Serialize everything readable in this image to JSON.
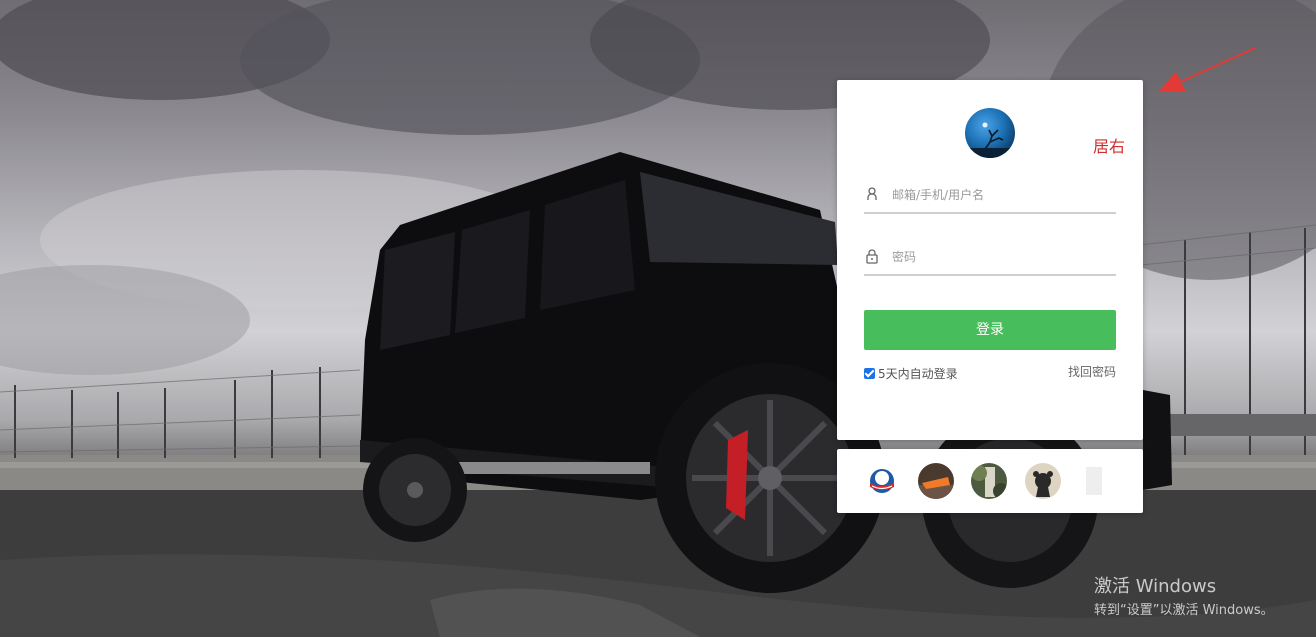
{
  "login": {
    "username_placeholder": "邮箱/手机/用户名",
    "password_placeholder": "密码",
    "submit_label": "登录",
    "remember_label": "5天内自动登录",
    "remember_checked": true,
    "forgot_label": "找回密码"
  },
  "annotation": {
    "label": "居右",
    "color": "#d12f2f"
  },
  "social_logins": [
    {
      "icon": "obama-logo-avatar"
    },
    {
      "icon": "orange-boat-avatar"
    },
    {
      "icon": "green-photo-avatar"
    },
    {
      "icon": "bear-avatar"
    },
    {
      "icon": "faded-avatar"
    }
  ],
  "watermark": {
    "title": "激活 Windows",
    "subtitle": "转到“设置”以激活 Windows。"
  },
  "colors": {
    "primary_button": "#47bd5b",
    "checkbox": "#1a73e8",
    "annotation_arrow": "#e53935"
  }
}
